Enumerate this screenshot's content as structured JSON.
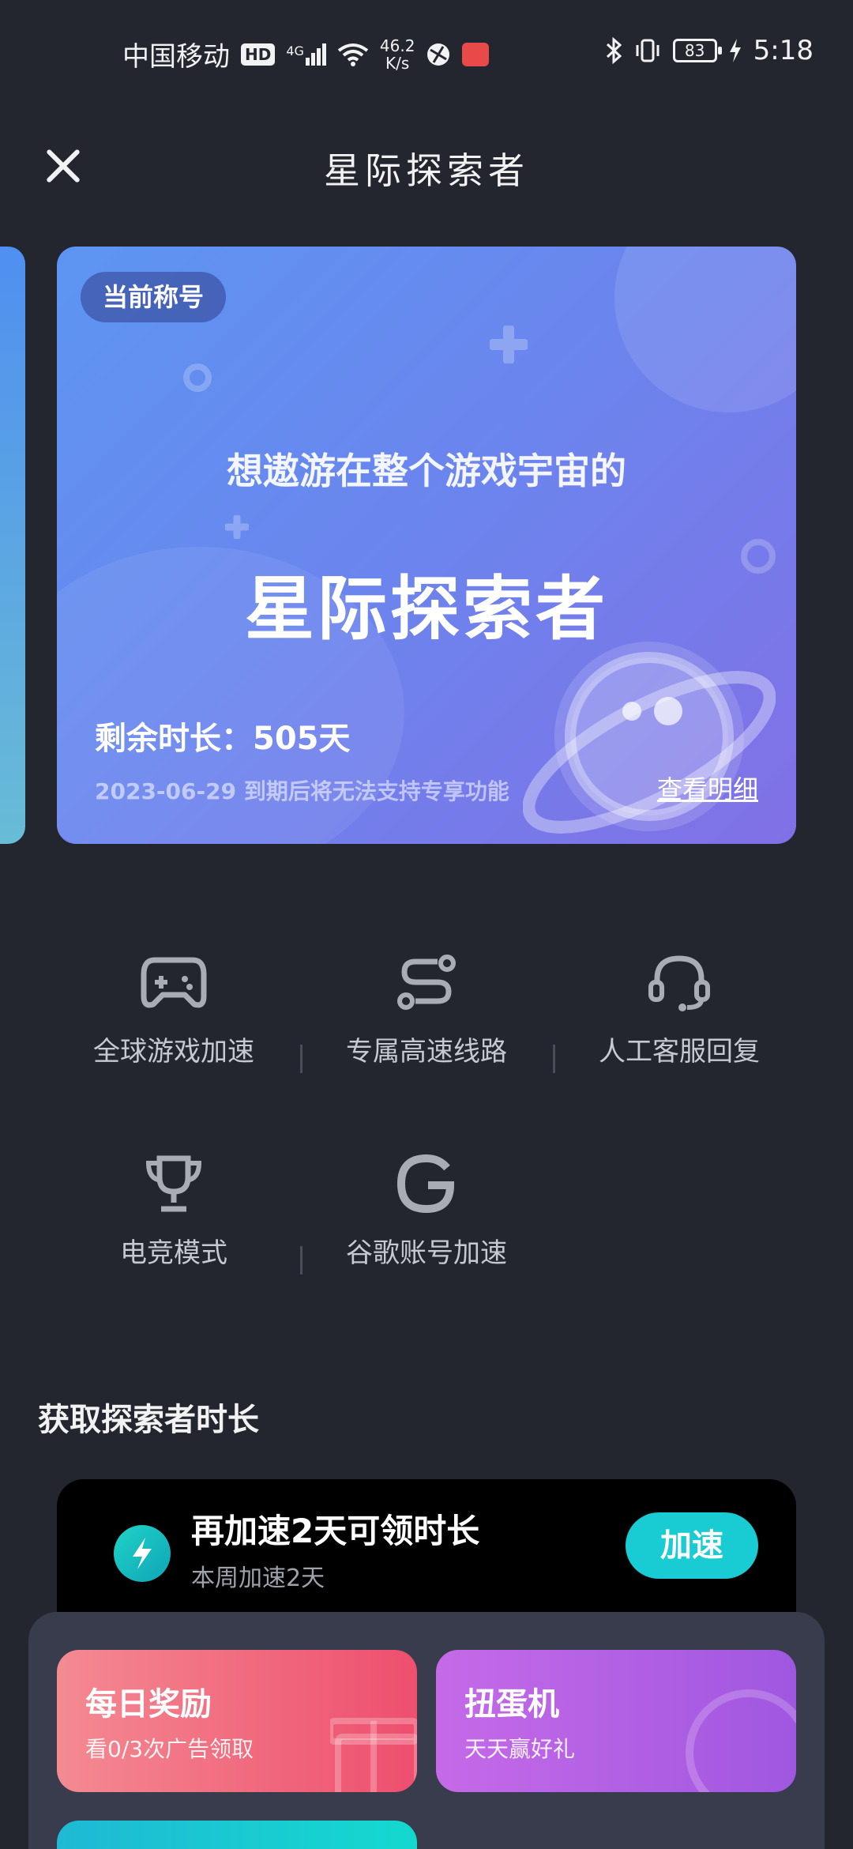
{
  "status_bar": {
    "carrier": "中国移动",
    "hd": "HD",
    "network": "4G",
    "speed_value": "46.2",
    "speed_unit": "K/s",
    "battery": "83",
    "time": "5:18"
  },
  "header": {
    "title": "星际探索者"
  },
  "title_card": {
    "badge": "当前称号",
    "subtitle": "想遨游在整个游戏宇宙的",
    "title": "星际探索者",
    "remaining": "剩余时长：505天",
    "expire_note": "2023-06-29 到期后将无法支持专享功能",
    "view_detail": "查看明细"
  },
  "features": [
    {
      "label": "全球游戏加速",
      "icon": "gamepad-icon"
    },
    {
      "label": "专属高速线路",
      "icon": "route-icon"
    },
    {
      "label": "人工客服回复",
      "icon": "headset-icon"
    },
    {
      "label": "电竞模式",
      "icon": "trophy-icon"
    },
    {
      "label": "谷歌账号加速",
      "icon": "google-icon"
    }
  ],
  "section": {
    "title": "获取探索者时长"
  },
  "task": {
    "title": "再加速2天可领时长",
    "subtitle": "本周加速2天",
    "button": "加速"
  },
  "rewards": [
    {
      "title": "每日奖励",
      "subtitle": "看0/3次广告领取",
      "color_from": "#f48a92",
      "color_to": "#ee4f6e"
    },
    {
      "title": "扭蛋机",
      "subtitle": "天天赢好礼",
      "color_from": "#c56ae8",
      "color_to": "#a057e0"
    }
  ]
}
